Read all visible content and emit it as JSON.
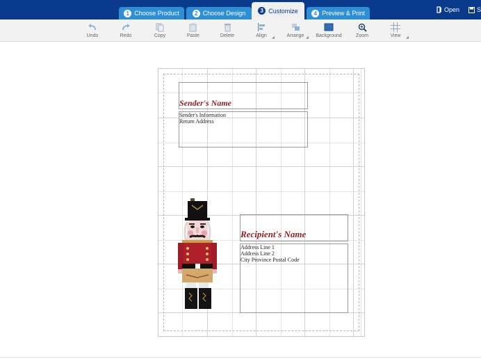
{
  "tabs": [
    {
      "num": "1",
      "label": "Choose Product"
    },
    {
      "num": "2",
      "label": "Choose Design"
    },
    {
      "num": "3",
      "label": "Customize"
    },
    {
      "num": "4",
      "label": "Preview & Print"
    }
  ],
  "header_actions": {
    "open_label": "Open",
    "save_label": "Sa"
  },
  "toolbar": {
    "undo": "Undo",
    "redo": "Redo",
    "copy": "Copy",
    "paste": "Paste",
    "delete": "Delete",
    "align": "Align",
    "arrange": "Arrange",
    "background": "Background",
    "zoom": "Zoom",
    "view": "View"
  },
  "sender": {
    "name": "Sender's Name",
    "info_line1": "Sender's Information",
    "info_line2": "Return Address"
  },
  "recipient": {
    "name": "Recipient's Name",
    "line1": "Address Line 1",
    "line2": "Address Line 2",
    "line3": "City Province Postal Code"
  },
  "colors": {
    "header": "#0a3a8c",
    "tab": "#2e8fd6",
    "name_text": "#9b1c1c"
  }
}
